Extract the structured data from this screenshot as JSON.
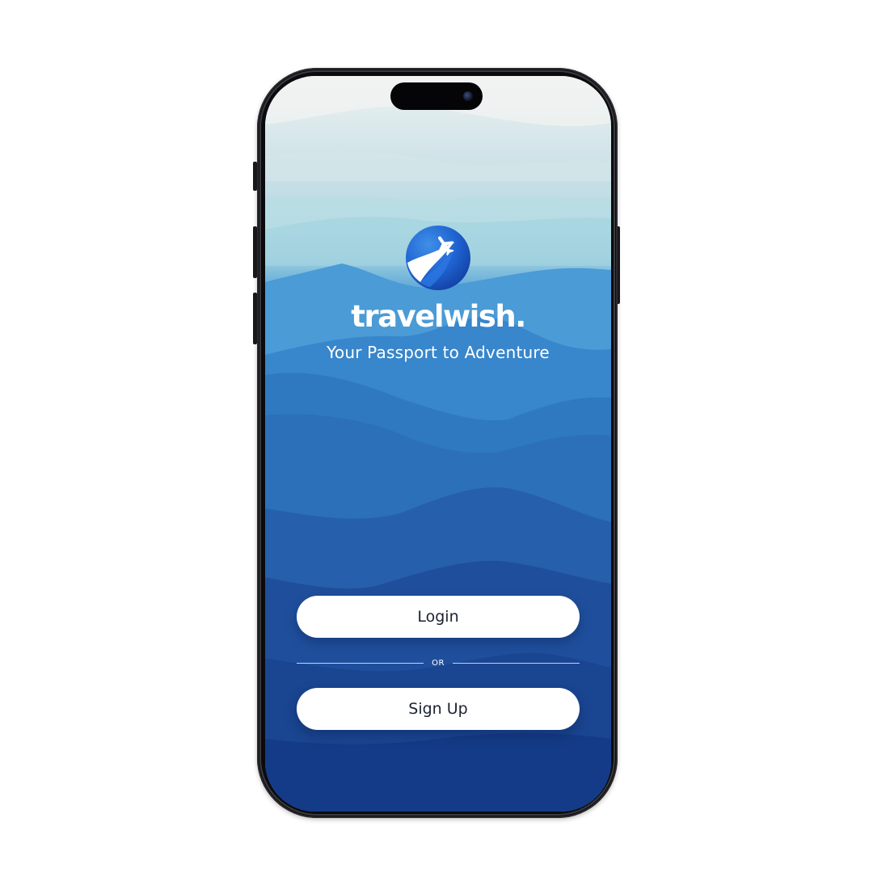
{
  "app": {
    "brand_name": "travelwish.",
    "tagline": "Your Passport to Adventure"
  },
  "actions": {
    "login_label": "Login",
    "divider_text": "OR",
    "signup_label": "Sign Up"
  },
  "icons": {
    "logo": "globe-airplane-icon",
    "camera": "front-camera-icon"
  },
  "colors": {
    "accent_blue": "#1f6fd6",
    "background_top": "#eef2f1",
    "background_bottom": "#123a86",
    "button_bg": "#ffffff",
    "button_text": "#1c2230"
  }
}
